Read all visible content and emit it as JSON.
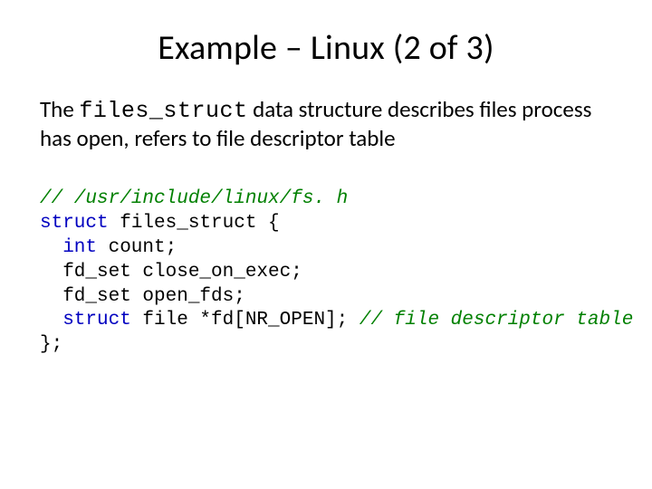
{
  "slide": {
    "title": "Example – Linux (2 of 3)",
    "body": {
      "pre": "The ",
      "mono": "files_struct",
      "post": " data structure describes files process has open, refers to file descriptor table"
    },
    "code": {
      "comment_header": "// /usr/include/linux/fs. h",
      "decl_kw": "struct",
      "decl_name": " files_struct {",
      "l1_kw": "int",
      "l1_rest": " count;",
      "l2_type": "fd_set ",
      "l2_rest": "close_on_exec;",
      "l3_type": "fd_set ",
      "l3_rest": "open_fds;",
      "l4_kw": "struct",
      "l4_mid": " file *fd[NR_OPEN]; ",
      "l4_comment": "// file descriptor table",
      "close": "};"
    }
  }
}
